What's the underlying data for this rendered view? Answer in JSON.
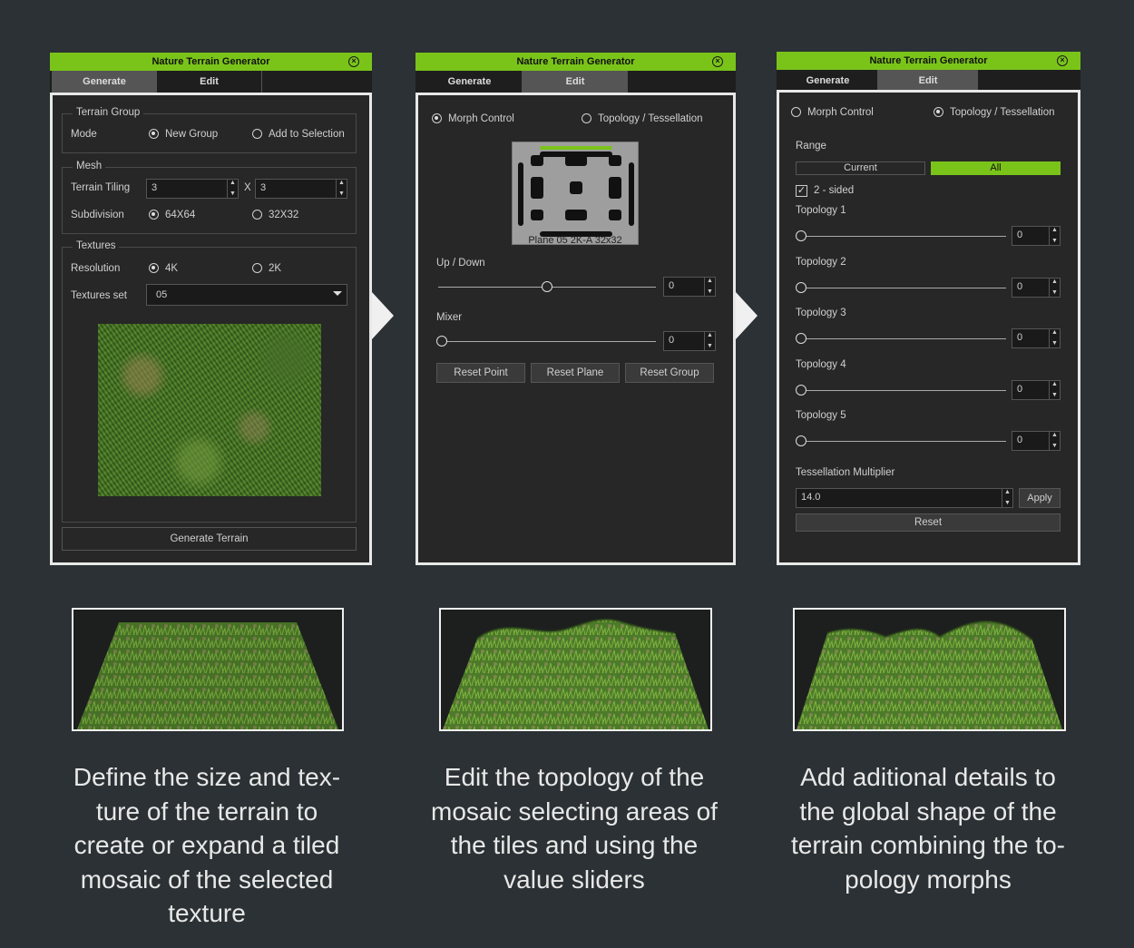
{
  "window_title": "Nature Terrain Generator",
  "tabs": {
    "generate": "Generate",
    "edit": "Edit"
  },
  "panel1": {
    "terrain_group": "Terrain Group",
    "mode_label": "Mode",
    "mode_new": "New Group",
    "mode_add": "Add to Selection",
    "mesh": "Mesh",
    "tiling_label": "Terrain Tiling",
    "tiling_x": "3",
    "tiling_sep": "X",
    "tiling_y": "3",
    "subdivision_label": "Subdivision",
    "sub_a": "64X64",
    "sub_b": "32X32",
    "textures": "Textures",
    "resolution_label": "Resolution",
    "res_a": "4K",
    "res_b": "2K",
    "texset_label": "Textures set",
    "texset_value": "05",
    "generate_btn": "Generate Terrain"
  },
  "panel2": {
    "morph": "Morph Control",
    "topology": "Topology / Tessellation",
    "plane_label": "Plane 05 2K-A 32x32",
    "updown": "Up / Down",
    "updown_value": "0",
    "updown_fraction": 0.5,
    "mixer": "Mixer",
    "mixer_value": "0",
    "mixer_fraction": 0.0,
    "reset_point": "Reset Point",
    "reset_plane": "Reset Plane",
    "reset_group": "Reset Group"
  },
  "panel3": {
    "morph": "Morph Control",
    "topology": "Topology / Tessellation",
    "range": "Range",
    "current": "Current",
    "all": "All",
    "two_sided": "2 -  sided",
    "topologies": [
      {
        "label": "Topology 1",
        "value": "0"
      },
      {
        "label": "Topology 2",
        "value": "0"
      },
      {
        "label": "Topology 3",
        "value": "0"
      },
      {
        "label": "Topology 4",
        "value": "0"
      },
      {
        "label": "Topology 5",
        "value": "0"
      }
    ],
    "tess_label": "Tessellation Multiplier",
    "tess_value": "14.0",
    "apply": "Apply",
    "reset": "Reset"
  },
  "captions": [
    "Define the size and tex-ture of the terrain to create or expand a tiled mosaic of the selected texture",
    "Edit the topology of the mosaic selecting areas of the tiles and using the value sliders",
    "Add aditional details to the global  shape of the terrain combining the to-pology morphs"
  ],
  "colors": {
    "accent": "#7ac41a",
    "background": "#2b3134"
  }
}
